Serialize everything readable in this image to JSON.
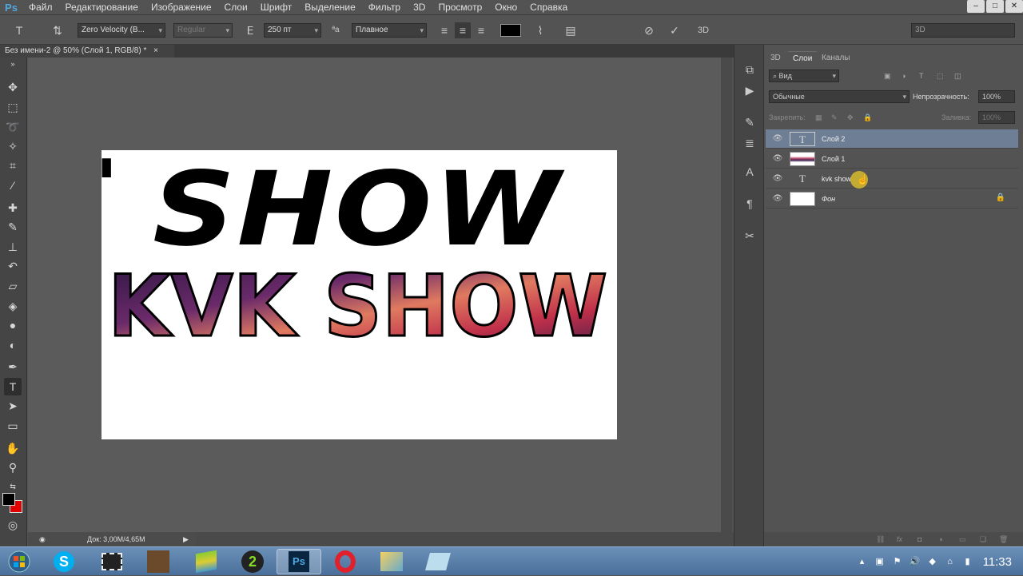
{
  "menubar": {
    "logo": "Ps",
    "items": [
      "Файл",
      "Редактирование",
      "Изображение",
      "Слои",
      "Шрифт",
      "Выделение",
      "Фильтр",
      "3D",
      "Просмотр",
      "Окно",
      "Справка"
    ]
  },
  "window_controls": {
    "minimize": "–",
    "maximize": "□",
    "close": "✕"
  },
  "options_bar": {
    "font_family": "Zero Velocity (B...",
    "font_style": "Regular",
    "font_size": "250 пт",
    "aa_label": "ªa",
    "antialias": "Плавное",
    "mode_3d": "3D",
    "workspace": "3D"
  },
  "document_tab": {
    "title": "Без имени-2 @ 50% (Слой 1, RGB/8) *",
    "close": "×"
  },
  "status_bar": {
    "doc_info": "Док: 3,00M/4,65M"
  },
  "canvas": {
    "text_top": "SHOW",
    "text_top_partial": "'",
    "text_bottom": "KVK SHOW"
  },
  "panel": {
    "tabs": [
      "3D",
      "Слои",
      "Каналы"
    ],
    "active_tab": "Слои",
    "filter_label": "Вид",
    "blend_mode": "Обычные",
    "opacity_label": "Непрозрачность:",
    "opacity_value": "100%",
    "lock_label": "Закрепить:",
    "fill_label": "Заливка:",
    "fill_value": "100%",
    "layers": [
      {
        "name": "Слой 2",
        "type": "text",
        "selected": true
      },
      {
        "name": "Слой 1",
        "type": "image",
        "selected": false
      },
      {
        "name": "kvk show",
        "type": "text",
        "selected": false
      },
      {
        "name": "Фон",
        "type": "background",
        "selected": false
      }
    ]
  },
  "taskbar": {
    "clock": "11:33"
  },
  "colors": {
    "ui_bg": "#535353",
    "selected_layer": "#6e7f95",
    "foreground": "#000000",
    "background": "#e00000"
  }
}
